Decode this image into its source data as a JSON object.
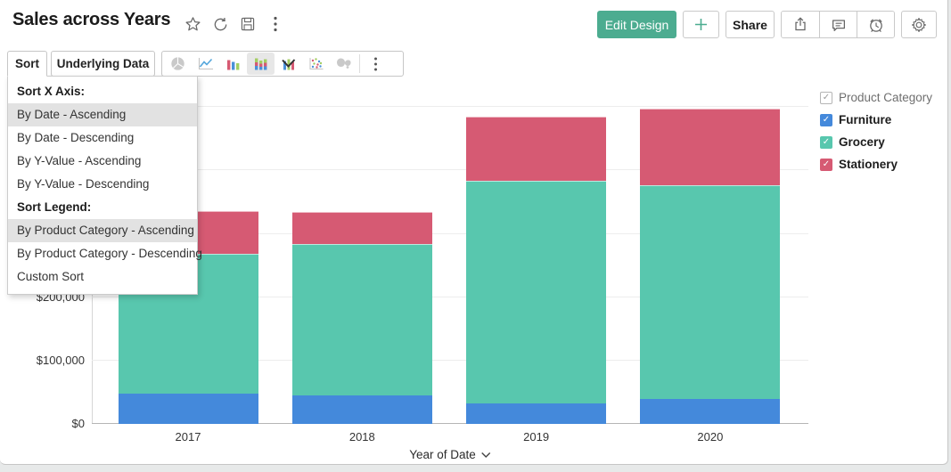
{
  "header": {
    "title": "Sales across Years",
    "title_icons": [
      "star-icon",
      "refresh-icon",
      "save-icon",
      "kebab-icon"
    ],
    "actions": {
      "edit_design_label": "Edit Design",
      "add_label": "+",
      "share_label": "Share",
      "icon_buttons": [
        "export-icon",
        "comment-icon",
        "alarm-icon",
        "settings-icon"
      ]
    }
  },
  "toolbar": {
    "sort_label": "Sort",
    "underlying_data_label": "Underlying Data",
    "chart_type_icons": [
      {
        "name": "pie-chart-icon",
        "state": "disabled"
      },
      {
        "name": "line-chart-icon",
        "state": "normal"
      },
      {
        "name": "bar-chart-icon",
        "state": "normal"
      },
      {
        "name": "stacked-bar-chart-icon",
        "state": "selected"
      },
      {
        "name": "combo-chart-icon",
        "state": "normal"
      },
      {
        "name": "scatter-chart-icon",
        "state": "normal"
      },
      {
        "name": "map-chart-icon",
        "state": "disabled"
      },
      {
        "name": "more-icon",
        "state": "normal"
      }
    ]
  },
  "sort_menu": {
    "items": [
      {
        "label": "Sort X Axis:",
        "type": "header",
        "highlighted": false
      },
      {
        "label": "By Date - Ascending",
        "type": "item",
        "highlighted": true
      },
      {
        "label": "By Date - Descending",
        "type": "item",
        "highlighted": false
      },
      {
        "label": "By Y-Value - Ascending",
        "type": "item",
        "highlighted": false
      },
      {
        "label": "By Y-Value - Descending",
        "type": "item",
        "highlighted": false
      },
      {
        "label": "Sort Legend:",
        "type": "header",
        "highlighted": false
      },
      {
        "label": "By Product Category - Ascending",
        "type": "item",
        "highlighted": true
      },
      {
        "label": "By Product Category - Descending",
        "type": "item",
        "highlighted": false
      },
      {
        "label": "Custom Sort",
        "type": "item",
        "highlighted": false
      }
    ]
  },
  "legend": {
    "title": "Product Category",
    "title_checked": true,
    "items": [
      {
        "label": "Furniture",
        "color": "#4489db",
        "checked": true
      },
      {
        "label": "Grocery",
        "color": "#58c7ae",
        "checked": true
      },
      {
        "label": "Stationery",
        "color": "#d65a73",
        "checked": true
      }
    ]
  },
  "chart_data": {
    "type": "bar",
    "stacked": true,
    "title": "Sales across Years",
    "categories": [
      "2017",
      "2018",
      "2019",
      "2020"
    ],
    "series": [
      {
        "name": "Furniture",
        "color": "#4489db",
        "values": [
          48000,
          45000,
          33000,
          40000
        ]
      },
      {
        "name": "Grocery",
        "color": "#58c7ae",
        "values": [
          221000,
          239000,
          351000,
          337000
        ]
      },
      {
        "name": "Stationery",
        "color": "#d65a73",
        "values": [
          67000,
          51000,
          101000,
          121000
        ]
      }
    ],
    "xlabel": "Year of Date",
    "ylabel": "",
    "ylim": [
      0,
      534000
    ],
    "y_gridline_interval": 100000,
    "visible_y_ticks": [
      {
        "label": "$0",
        "value": 0
      },
      {
        "label": "$100,000",
        "value": 100000
      },
      {
        "label": "$200,000",
        "value": 200000
      }
    ],
    "legend_position": "right",
    "grid": "horizontal"
  },
  "colors": {
    "accent_green": "#4cac90",
    "bar_blue": "#4489db",
    "bar_teal": "#58c7ae",
    "bar_red": "#d65a73",
    "menu_highlight": "#e2e2e2"
  }
}
